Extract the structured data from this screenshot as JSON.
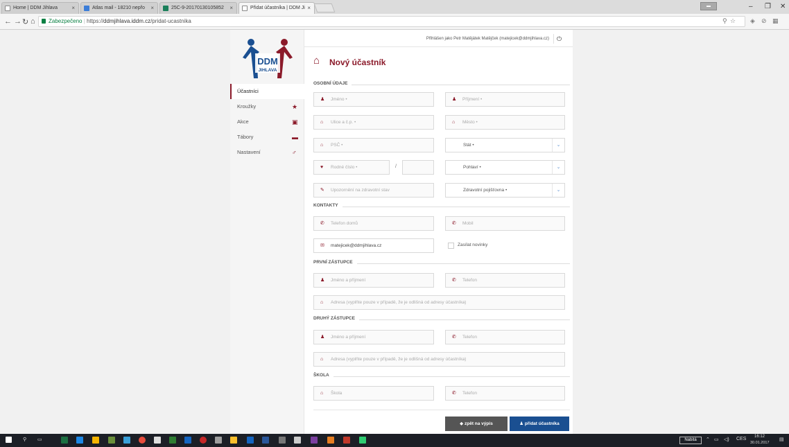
{
  "browser": {
    "tabs": [
      {
        "label": "Home | DDM Jihlava"
      },
      {
        "label": "Atlas mail - 18210 nepřo"
      },
      {
        "label": "25C-9-20170130105852"
      },
      {
        "label": "Přidat účastníka | DDM Ji"
      }
    ],
    "secure_label": "Zabezpečeno",
    "url_prefix": "https://",
    "url_host": "ddmjihlava.iddm.cz",
    "url_path": "/pridat-ucastnika"
  },
  "logo": {
    "line1": "DDM",
    "line2": "JIHLAVA",
    "color_blue": "#1a4f91",
    "color_red": "#8b1a2a"
  },
  "sidebar": {
    "items": [
      {
        "label": "Účastníci",
        "icon": ""
      },
      {
        "label": "Kroužky",
        "icon": "star-icon"
      },
      {
        "label": "Akce",
        "icon": "calendar-icon"
      },
      {
        "label": "Tábory",
        "icon": "briefcase-icon"
      },
      {
        "label": "Nastavení",
        "icon": "gender-icon"
      }
    ]
  },
  "header": {
    "logged_in": "Přihlášen jako Petr Matějátek Matějček (matejicek@ddmjihlava.cz)",
    "title": "Nový účastník"
  },
  "sections": {
    "personal": "OSOBNÍ ÚDAJE",
    "contacts": "KONTAKTY",
    "first_guardian": "PRVNÍ ZÁSTUPCE",
    "second_guardian": "DRUHÝ ZÁSTUPCE",
    "school": "ŠKOLA"
  },
  "fields": {
    "first_name": "Jméno •",
    "last_name": "Příjmení •",
    "street": "Ulice a č.p. •",
    "city": "Město •",
    "zip": "PSČ •",
    "country": "Stát •",
    "birth_number": "Rodné číslo •",
    "birth_slash": "/",
    "gender": "Pohlaví •",
    "health_note": "Upozornění na zdravotní stav",
    "insurance": "Zdravotní pojišťovna •",
    "phone_home": "Telefon domů",
    "mobile": "Mobil",
    "email": "matejicek@ddmjihlava.cz",
    "newsletter": "Zasílat novinky",
    "g1_name": "Jméno a příjmení",
    "g1_phone": "Telefon",
    "g1_address": "Adresa (vyplňte pouze v případě, že je odlišná od adresy účastníka)",
    "g2_name": "Jméno a příjmení",
    "g2_phone": "Telefon",
    "g2_address": "Adresa (vyplňte pouze v případě, že je odlišná od adresy účastníka)",
    "school": "Škola",
    "school_phone": "Telefon"
  },
  "buttons": {
    "back": "zpět na výpis",
    "add": "přidat účastníka"
  },
  "taskbar": {
    "keyboard": "CES",
    "time": "16:12",
    "date": "30.01.2017",
    "nabita": "Nabitá"
  }
}
